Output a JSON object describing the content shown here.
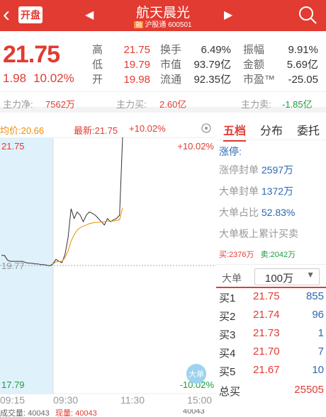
{
  "header": {
    "badge": "开盘",
    "title": "航天晨光",
    "rong": "融",
    "market": "沪股通",
    "code": "600501"
  },
  "quote": {
    "price": "21.75",
    "change": "1.98",
    "pct": "10.02%",
    "cells": [
      {
        "l": "高",
        "v": "21.75",
        "c": "v"
      },
      {
        "l": "换手",
        "v": "6.49%",
        "c": "vb"
      },
      {
        "l": "振幅",
        "v": "9.91%",
        "c": "vb"
      },
      {
        "l": "低",
        "v": "19.79",
        "c": "v"
      },
      {
        "l": "市值",
        "v": "93.79亿",
        "c": "vb"
      },
      {
        "l": "金额",
        "v": "5.69亿",
        "c": "vb"
      },
      {
        "l": "开",
        "v": "19.98",
        "c": "v"
      },
      {
        "l": "流通",
        "v": "92.35亿",
        "c": "vb"
      },
      {
        "l": "市盈™",
        "v": "-25.05",
        "c": "vb"
      }
    ]
  },
  "flow": {
    "net_label": "主力净:",
    "net": "7562万",
    "buy_label": "主力买:",
    "buy": "2.60亿",
    "sell_label": "主力卖:",
    "sell": "-1.85亿"
  },
  "chart_head": {
    "avg": "均价:20.66",
    "latest": "最新:21.75",
    "pct": "+10.02%"
  },
  "chart_labels": {
    "top_price": "21.75",
    "top_pct": "+10.02%",
    "mid_price": "19.77",
    "low_price": "17.79",
    "low_pct": "-10.02%",
    "big_order": "大单"
  },
  "chart_data": {
    "type": "line",
    "series": [
      {
        "values": [
          19.93,
          19.93,
          19.86,
          19.84,
          19.84,
          19.84,
          19.84,
          19.84,
          19.82,
          19.81,
          19.81,
          19.8,
          19.8,
          19.79,
          19.79,
          19.78,
          19.77,
          19.8,
          19.87,
          19.84,
          19.82,
          19.95,
          20.2,
          20.65,
          20.5,
          20.6,
          20.55,
          20.45,
          20.55,
          20.6,
          20.58,
          20.55,
          20.5,
          20.45,
          20.4,
          20.5,
          20.45,
          20.48,
          20.5,
          20.55,
          21.75
        ]
      },
      {
        "values": [
          null,
          null,
          null,
          null,
          null,
          null,
          null,
          null,
          null,
          null,
          null,
          null,
          null,
          null,
          null,
          null,
          null,
          19.8,
          19.83,
          19.84,
          19.84,
          19.9,
          20.0,
          20.15,
          20.25,
          20.32,
          20.36,
          20.38,
          20.4,
          20.42,
          20.43,
          20.44,
          20.44,
          20.45,
          20.45,
          20.46,
          20.46,
          20.46,
          20.47,
          20.48,
          20.66
        ]
      }
    ],
    "ylim": [
      17.79,
      21.75
    ]
  },
  "times": [
    "09:15",
    "09:30",
    "11:30",
    "15:00"
  ],
  "bottom": {
    "vol": "成交量: 40043",
    "cur": "现量: 40043",
    "right": "40043"
  },
  "tabs": [
    "五档",
    "分布",
    "委托"
  ],
  "panel": {
    "title": "涨停:",
    "rows": [
      {
        "l": "涨停封单",
        "v": "2597万"
      },
      {
        "l": "大单封单",
        "v": "1372万"
      },
      {
        "l": "大单占比",
        "v": "52.83%"
      }
    ],
    "accum": "大单板上累计买卖",
    "buy_l": "买:",
    "buy": "2376万",
    "sell_l": "卖:",
    "sell": "2042万"
  },
  "selector": {
    "label": "大单",
    "value": "100万"
  },
  "book": [
    {
      "l": "买1",
      "p": "21.75",
      "q": "855"
    },
    {
      "l": "买2",
      "p": "21.74",
      "q": "96"
    },
    {
      "l": "买3",
      "p": "21.73",
      "q": "1"
    },
    {
      "l": "买4",
      "p": "21.70",
      "q": "7"
    },
    {
      "l": "买5",
      "p": "21.67",
      "q": "10"
    }
  ],
  "total": {
    "l": "总买",
    "v": "25505"
  }
}
